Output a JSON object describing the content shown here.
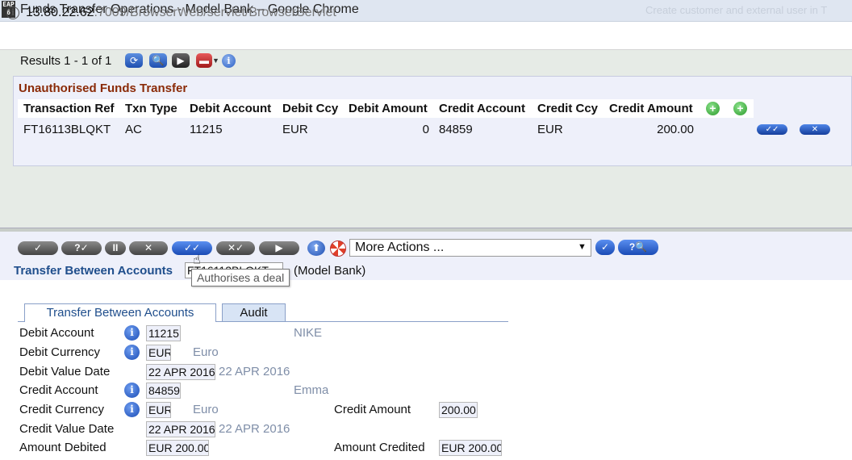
{
  "window": {
    "app_icon_text": "EAP 6",
    "title": "Funds Transfer Operations - Model Bank – Google Chrome",
    "ghost_title": "Create customer and external user in T"
  },
  "address": {
    "host": "13.80.22.62",
    "rest": ":7009/BrowserWeb/servlet/BrowserServlet"
  },
  "results": {
    "text": "Results 1 - 1 of 1"
  },
  "enquiry": {
    "title": "Unauthorised Funds Transfer",
    "columns": [
      "Transaction Ref",
      "Txn Type",
      "Debit Account",
      "Debit Ccy",
      "Debit Amount",
      "Credit Account",
      "Credit Ccy",
      "Credit Amount"
    ],
    "rows": [
      [
        "FT16113BLQKT",
        "AC",
        "11215",
        "EUR",
        "0",
        "84859",
        "EUR",
        "200.00"
      ]
    ],
    "authorise_icon": "✓✓",
    "delete_icon": "✕"
  },
  "toolbar": {
    "commit": "✓",
    "validate": "?✓",
    "hold": "II",
    "delete": "✕",
    "authorise": "✓✓",
    "reverse": "✕✓",
    "next": "▶",
    "up": "⬆",
    "more_actions": "More Actions ...",
    "go": "✓",
    "help_find": "?🔍"
  },
  "record": {
    "version_title": "Transfer Between Accounts",
    "txn_id": "FT16113BLQKT",
    "company": "(Model Bank)",
    "tooltip": "Authorises a deal"
  },
  "tabs": {
    "main": "Transfer Between Accounts",
    "audit": "Audit"
  },
  "fields": {
    "debit_account": {
      "label": "Debit Account",
      "value": "11215",
      "enrich": "NIKE"
    },
    "debit_currency": {
      "label": "Debit Currency",
      "value": "EUR",
      "enrich": "Euro"
    },
    "debit_value_date": {
      "label": "Debit Value Date",
      "value": "22 APR 2016",
      "enrich": "22 APR 2016"
    },
    "credit_account": {
      "label": "Credit Account",
      "value": "84859",
      "enrich": "Emma"
    },
    "credit_currency": {
      "label": "Credit Currency",
      "value": "EUR",
      "enrich": "Euro"
    },
    "credit_amount": {
      "label": "Credit Amount",
      "value": "200.00"
    },
    "credit_value_date": {
      "label": "Credit Value Date",
      "value": "22 APR 2016",
      "enrich": "22 APR 2016"
    },
    "amount_debited": {
      "label": "Amount Debited",
      "value": "EUR 200.00"
    },
    "amount_credited": {
      "label": "Amount Credited",
      "value": "EUR 200.00"
    }
  },
  "icons": {
    "refresh": "refresh-icon",
    "find": "magnifier-icon",
    "next": "play-icon",
    "tools": "toolbox-icon",
    "info": "info-icon",
    "add": "plus-icon",
    "help": "lifebuoy-icon"
  },
  "colors": {
    "enquiry_title": "#8a2a07",
    "version_title": "#1f4e8c",
    "button_blue": "#1a4bb5",
    "button_grey": "#555555",
    "add_green": "#2b9a2b",
    "enrichment": "#7f8ea8"
  }
}
